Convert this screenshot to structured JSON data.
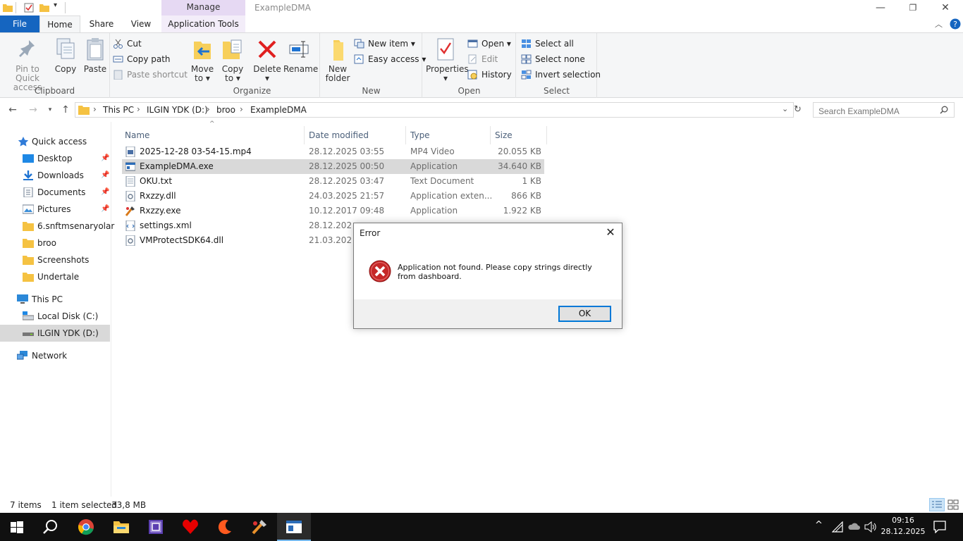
{
  "window": {
    "title": "ExampleDMA",
    "contextual_tab_group": "Manage",
    "minimize": "—",
    "restore": "❐",
    "close": "✕"
  },
  "tabs": {
    "file": "File",
    "home": "Home",
    "share": "Share",
    "view": "View",
    "application_tools": "Application Tools"
  },
  "ribbon": {
    "clipboard": {
      "label": "Clipboard",
      "pin_to_quick_access": [
        "Pin to Quick",
        "access"
      ],
      "copy": "Copy",
      "paste": "Paste",
      "cut": "Cut",
      "copy_path": "Copy path",
      "paste_shortcut": "Paste shortcut"
    },
    "organize": {
      "label": "Organize",
      "move_to": [
        "Move",
        "to ▾"
      ],
      "copy_to": [
        "Copy",
        "to ▾"
      ],
      "delete": [
        "Delete",
        "▾"
      ],
      "rename": "Rename"
    },
    "new": {
      "label": "New",
      "new_folder": [
        "New",
        "folder"
      ],
      "new_item": "New item ▾",
      "easy_access": "Easy access ▾"
    },
    "open": {
      "label": "Open",
      "properties": [
        "Properties",
        "▾"
      ],
      "open": "Open ▾",
      "edit": "Edit",
      "history": "History"
    },
    "select": {
      "label": "Select",
      "select_all": "Select all",
      "select_none": "Select none",
      "invert_selection": "Invert selection"
    }
  },
  "address": {
    "breadcrumbs": [
      "This PC",
      "ILGIN YDK (D:)",
      "broo",
      "ExampleDMA"
    ],
    "search_placeholder": "Search ExampleDMA"
  },
  "navpane": {
    "quick_access": "Quick access",
    "quick_items": [
      "Desktop",
      "Downloads",
      "Documents",
      "Pictures",
      "6.snftmsenaryolar",
      "broo",
      "Screenshots",
      "Undertale"
    ],
    "this_pc": "This PC",
    "drives": [
      "Local Disk (C:)",
      "ILGIN YDK (D:)"
    ],
    "network": "Network"
  },
  "columns": {
    "name": "Name",
    "date_modified": "Date modified",
    "type": "Type",
    "size": "Size"
  },
  "files": [
    {
      "name": "2025-12-28 03-54-15.mp4",
      "date": "28.12.2025 03:55",
      "type": "MP4 Video",
      "size": "20.055 KB"
    },
    {
      "name": "ExampleDMA.exe",
      "date": "28.12.2025 00:50",
      "type": "Application",
      "size": "34.640 KB"
    },
    {
      "name": "OKU.txt",
      "date": "28.12.2025 03:47",
      "type": "Text Document",
      "size": "1 KB"
    },
    {
      "name": "Rxzzy.dll",
      "date": "24.03.2025 21:57",
      "type": "Application exten...",
      "size": "866 KB"
    },
    {
      "name": "Rxzzy.exe",
      "date": "10.12.2017 09:48",
      "type": "Application",
      "size": "1.922 KB"
    },
    {
      "name": "settings.xml",
      "date": "28.12.2025 0",
      "type": "",
      "size": ""
    },
    {
      "name": "VMProtectSDK64.dll",
      "date": "21.03.2023 1",
      "type": "",
      "size": ""
    }
  ],
  "dialog": {
    "title": "Error",
    "message": "Application not found. Please copy strings directly from dashboard.",
    "ok": "OK",
    "close": "✕"
  },
  "status": {
    "item_count": "7 items",
    "selection": "1 item selected",
    "selection_size": "33,8 MB"
  },
  "taskbar": {
    "time": "09:16",
    "date": "28.12.2025"
  },
  "colors": {
    "file_tab": "#1565c0",
    "manage_tab": "#e6d9f3",
    "selection": "#d9d9d9",
    "taskbar": "#101010"
  }
}
